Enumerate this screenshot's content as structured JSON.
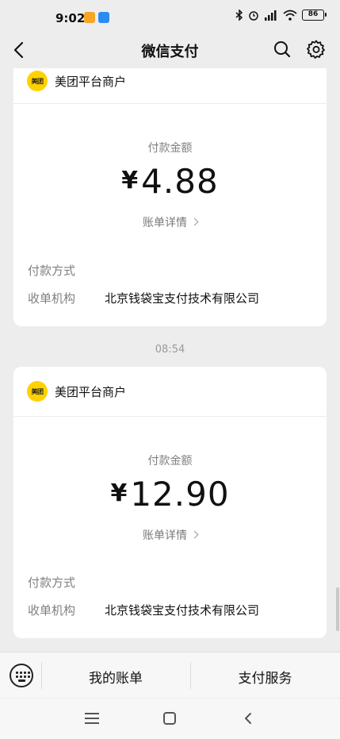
{
  "status_bar": {
    "time": "9:02",
    "battery": "86"
  },
  "nav": {
    "title": "微信支付"
  },
  "records": [
    {
      "merchant_logo_text": "美团",
      "merchant": "美团平台商户",
      "amount_label": "付款金额",
      "currency": "¥",
      "amount": "4.88",
      "bill_detail": "账单详情",
      "payment_method_label": "付款方式",
      "payment_method_value": "",
      "collector_label": "收单机构",
      "collector_value": "北京钱袋宝支付技术有限公司"
    },
    {
      "time_separator": "08:54",
      "merchant_logo_text": "美团",
      "merchant": "美团平台商户",
      "amount_label": "付款金额",
      "currency": "¥",
      "amount": "12.90",
      "bill_detail": "账单详情",
      "payment_method_label": "付款方式",
      "payment_method_value": "",
      "collector_label": "收单机构",
      "collector_value": "北京钱袋宝支付技术有限公司"
    }
  ],
  "bottom_bar": {
    "tabs": [
      {
        "label": "我的账单"
      },
      {
        "label": "支付服务"
      }
    ]
  },
  "colors": {
    "background": "#ededed",
    "card": "#ffffff",
    "meituan_yellow": "#ffd100",
    "secondary_text": "#808080"
  },
  "icons": [
    "back-arrow-icon",
    "search-icon",
    "gear-icon",
    "keyboard-icon",
    "menu-icon",
    "home-icon",
    "back-icon"
  ]
}
